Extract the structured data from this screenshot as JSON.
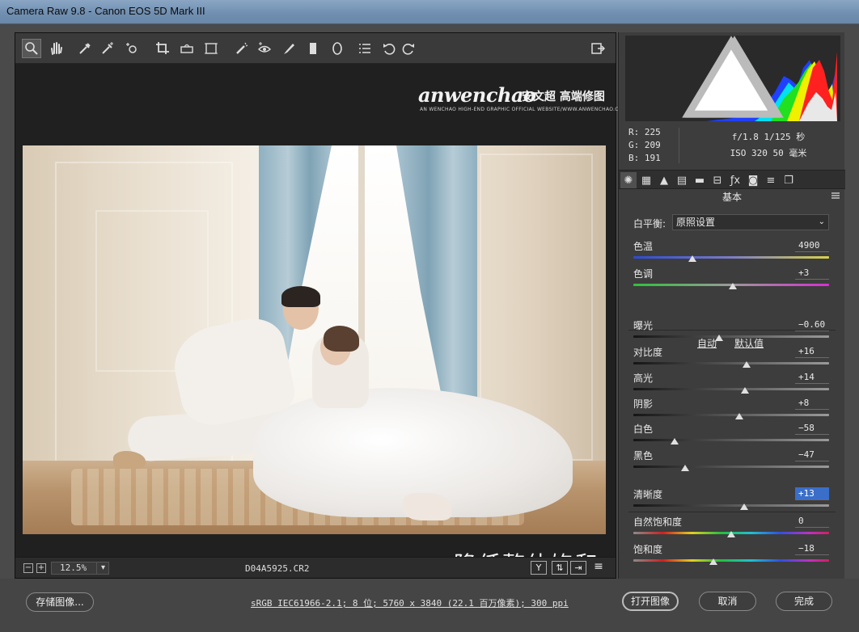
{
  "window": {
    "title": "Camera Raw 9.8 -  Canon EOS 5D Mark III"
  },
  "toolbar": {
    "tools": [
      {
        "name": "zoom-tool",
        "icon": "magnifier-icon",
        "active": true
      },
      {
        "name": "hand-tool",
        "icon": "hand-icon"
      },
      {
        "name": "white-balance-tool",
        "icon": "eyedropper-icon"
      },
      {
        "name": "color-sampler-tool",
        "icon": "color-sampler-icon"
      },
      {
        "name": "targeted-adjustment-tool",
        "icon": "targeted-adjustment-icon"
      },
      {
        "name": "crop-tool",
        "icon": "crop-icon"
      },
      {
        "name": "straighten-tool",
        "icon": "level-icon"
      },
      {
        "name": "transform-tool",
        "icon": "transform-icon"
      },
      {
        "name": "spot-removal-tool",
        "icon": "brush-heal-icon"
      },
      {
        "name": "red-eye-tool",
        "icon": "red-eye-icon"
      },
      {
        "name": "adjustment-brush-tool",
        "icon": "brush-icon"
      },
      {
        "name": "graduated-filter-tool",
        "icon": "gradient-icon"
      },
      {
        "name": "radial-filter-tool",
        "icon": "ellipse-icon"
      },
      {
        "name": "preferences-button",
        "icon": "list-icon"
      },
      {
        "name": "rotate-left-button",
        "icon": "rotate-ccw-icon"
      },
      {
        "name": "rotate-right-button",
        "icon": "rotate-cw-icon"
      }
    ],
    "fullscreen_icon": "fullscreen-toggle-icon"
  },
  "watermark": {
    "brand": "anwenchao",
    "brand_cn": "安文超 高端修图",
    "subtitle": "AN WENCHAO HIGH-END GRAPHIC OFFICIAL WEBSITE/WWW.ANWENCHAO.COM"
  },
  "caption": "降低整体饱和",
  "statusbar": {
    "zoom_out": "−",
    "zoom_in": "+",
    "zoom_level": "12.5%",
    "filename": "D04A5925.CR2",
    "icons": [
      "before-after-y-icon",
      "swap-icon",
      "copy-settings-icon",
      "preview-settings-icon"
    ],
    "icon_glyphs": [
      "Y",
      "⇅",
      "⇥",
      "≡"
    ]
  },
  "histogram": {
    "colors": {
      "red": "#ff2020",
      "green": "#20e020",
      "blue": "#2040ff",
      "yellow": "#f0f000",
      "cyan": "#00e0f0",
      "white": "#e8e8e8"
    }
  },
  "readout": {
    "r": "R:  225",
    "g": "G:  209",
    "b": "B:  191",
    "exposure": "f/1.8   1/125 秒",
    "iso": "ISO 320   50 毫米"
  },
  "panel_tabs": [
    {
      "icon": "aperture-icon",
      "active": true
    },
    {
      "icon": "grid-icon"
    },
    {
      "icon": "mountains-icon"
    },
    {
      "icon": "split-toning-icon"
    },
    {
      "icon": "hsl-icon"
    },
    {
      "icon": "lens-icon"
    },
    {
      "icon": "fx-icon"
    },
    {
      "icon": "camera-icon"
    },
    {
      "icon": "presets-icon"
    },
    {
      "icon": "snapshots-icon"
    }
  ],
  "basic": {
    "title": "基本",
    "wb_label": "白平衡:",
    "wb_value": "原照设置",
    "auto": "自动",
    "default": "默认值",
    "sliders": [
      {
        "id": "temperature",
        "label": "色温",
        "value": "4900",
        "pos": 0.3,
        "track": "temp"
      },
      {
        "id": "tint",
        "label": "色调",
        "value": "+3",
        "pos": 0.51,
        "track": "tint"
      },
      {
        "id": "exposure",
        "label": "曝光",
        "value": "−0.60",
        "pos": 0.44,
        "track": "gray"
      },
      {
        "id": "contrast",
        "label": "对比度",
        "value": "+16",
        "pos": 0.58,
        "track": "gray"
      },
      {
        "id": "highlights",
        "label": "高光",
        "value": "+14",
        "pos": 0.57,
        "track": "gray"
      },
      {
        "id": "shadows",
        "label": "阴影",
        "value": "+8",
        "pos": 0.54,
        "track": "gray"
      },
      {
        "id": "whites",
        "label": "白色",
        "value": "−58",
        "pos": 0.21,
        "track": "gray"
      },
      {
        "id": "blacks",
        "label": "黑色",
        "value": "−47",
        "pos": 0.265,
        "track": "gray"
      },
      {
        "id": "clarity",
        "label": "清晰度",
        "value": "+13",
        "pos": 0.565,
        "track": "gray",
        "selected": true
      },
      {
        "id": "vibrance",
        "label": "自然饱和度",
        "value": "0",
        "pos": 0.5,
        "track": "rainbow"
      },
      {
        "id": "saturation",
        "label": "饱和度",
        "value": "−18",
        "pos": 0.41,
        "track": "rainbow"
      }
    ]
  },
  "bottom": {
    "save_label": "存储图像...",
    "workflow": "sRGB IEC61966-2.1; 8 位; 5760 x 3840 (22.1 百万像素); 300 ppi",
    "open_label": "打开图像",
    "cancel_label": "取消",
    "done_label": "完成"
  }
}
